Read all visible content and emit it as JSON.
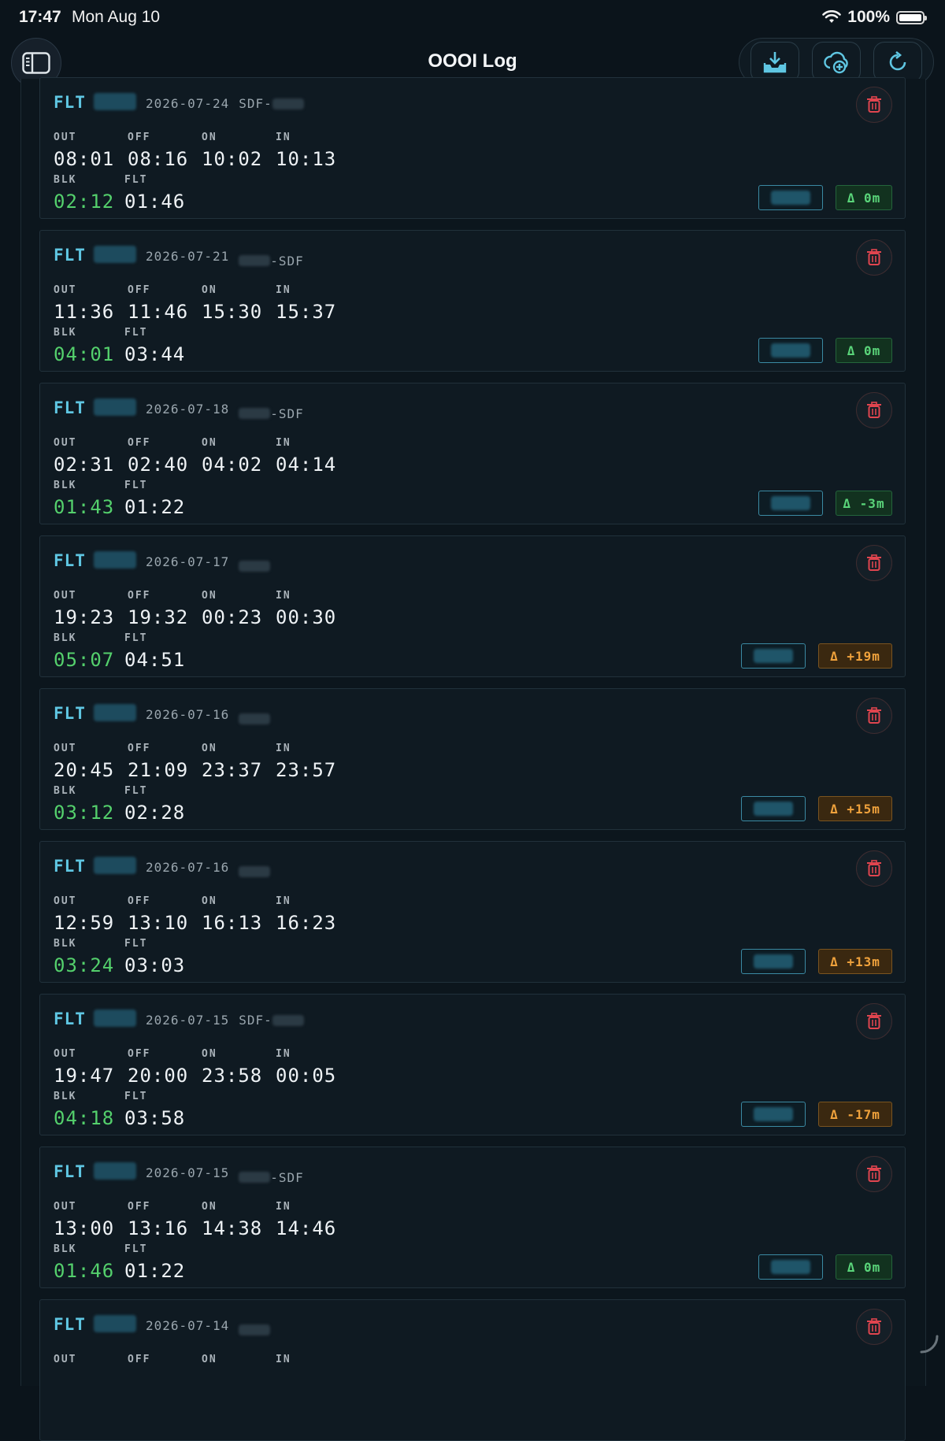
{
  "status_bar": {
    "time": "17:47",
    "date": "Mon Aug 10",
    "battery": "100%"
  },
  "nav": {
    "title": "OOOI Log",
    "icons": {
      "sidebar": "sidebar-toggle-icon",
      "import": "tray-download-icon",
      "cloud": "cloud-add-icon",
      "refresh": "refresh-icon"
    }
  },
  "labels": {
    "flt": "FLT",
    "out": "OUT",
    "off": "OFF",
    "on": "ON",
    "in": "IN",
    "blk": "BLK",
    "flt_time": "FLT"
  },
  "entries": [
    {
      "date": "2026-07-24",
      "route_prefix": "SDF-",
      "route_suffix": "",
      "out": "08:01",
      "off": "08:16",
      "on": "10:02",
      "in": "10:13",
      "blk": "02:12",
      "flt": "01:46",
      "delta": "Δ 0m",
      "delta_status": "green"
    },
    {
      "date": "2026-07-21",
      "route_prefix": "",
      "route_suffix": "-SDF",
      "out": "11:36",
      "off": "11:46",
      "on": "15:30",
      "in": "15:37",
      "blk": "04:01",
      "flt": "03:44",
      "delta": "Δ 0m",
      "delta_status": "green"
    },
    {
      "date": "2026-07-18",
      "route_prefix": "",
      "route_suffix": "-SDF",
      "out": "02:31",
      "off": "02:40",
      "on": "04:02",
      "in": "04:14",
      "blk": "01:43",
      "flt": "01:22",
      "delta": "Δ -3m",
      "delta_status": "green"
    },
    {
      "date": "2026-07-17",
      "route_prefix": "",
      "route_suffix": "",
      "out": "19:23",
      "off": "19:32",
      "on": "00:23",
      "in": "00:30",
      "blk": "05:07",
      "flt": "04:51",
      "delta": "Δ +19m",
      "delta_status": "orange"
    },
    {
      "date": "2026-07-16",
      "route_prefix": "",
      "route_suffix": "",
      "out": "20:45",
      "off": "21:09",
      "on": "23:37",
      "in": "23:57",
      "blk": "03:12",
      "flt": "02:28",
      "delta": "Δ +15m",
      "delta_status": "orange"
    },
    {
      "date": "2026-07-16",
      "route_prefix": "",
      "route_suffix": "",
      "out": "12:59",
      "off": "13:10",
      "on": "16:13",
      "in": "16:23",
      "blk": "03:24",
      "flt": "03:03",
      "delta": "Δ +13m",
      "delta_status": "orange"
    },
    {
      "date": "2026-07-15",
      "route_prefix": "SDF-",
      "route_suffix": "",
      "out": "19:47",
      "off": "20:00",
      "on": "23:58",
      "in": "00:05",
      "blk": "04:18",
      "flt": "03:58",
      "delta": "Δ -17m",
      "delta_status": "orange"
    },
    {
      "date": "2026-07-15",
      "route_prefix": "",
      "route_suffix": "-SDF",
      "out": "13:00",
      "off": "13:16",
      "on": "14:38",
      "in": "14:46",
      "blk": "01:46",
      "flt": "01:22",
      "delta": "Δ 0m",
      "delta_status": "green"
    },
    {
      "date": "2026-07-14",
      "route_prefix": "",
      "route_suffix": "",
      "out": "",
      "off": "",
      "on": "",
      "in": "",
      "blk": "",
      "flt": "",
      "delta": "",
      "delta_status": "green"
    }
  ],
  "colors": {
    "accent": "#5fc6e2",
    "blk_green": "#54d06c",
    "delete_red": "#e0454f",
    "delta_green": "#5ad57a",
    "delta_orange": "#f0a23c"
  }
}
